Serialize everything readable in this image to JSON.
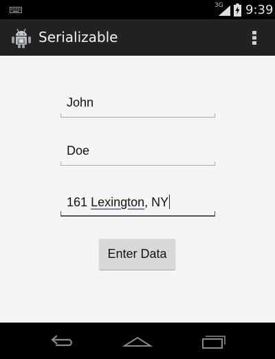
{
  "status_bar": {
    "network": "3G",
    "time": "9:39",
    "icons": [
      "keyboard-icon",
      "signal-icon",
      "battery-charging-icon"
    ]
  },
  "action_bar": {
    "title": "Serializable",
    "icons": [
      "android-app-icon",
      "overflow-menu-icon"
    ]
  },
  "form": {
    "first_name": "John",
    "last_name": "Doe",
    "address_number": "161",
    "address_street": "Lexington",
    "address_rest": ", NY",
    "submit_label": "Enter Data"
  },
  "nav_bar": {
    "icons": [
      "back-icon",
      "home-icon",
      "recent-apps-icon"
    ]
  },
  "colors": {
    "status_bar": "#000000",
    "action_bar": "#222222",
    "content_bg": "#f5f5f5",
    "button_bg": "#d8d8d8"
  }
}
